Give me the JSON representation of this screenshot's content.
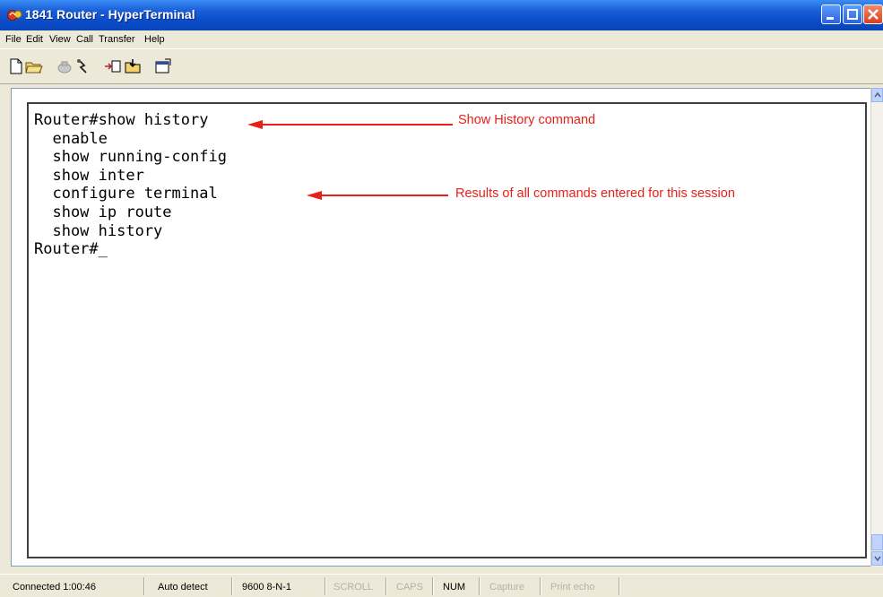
{
  "window": {
    "title": "1841 Router - HyperTerminal"
  },
  "menu": {
    "file": "File",
    "edit": "Edit",
    "view": "View",
    "call": "Call",
    "transfer": "Transfer",
    "help": "Help"
  },
  "toolbar": {
    "icons": [
      "new-icon",
      "open-icon",
      "connect-icon",
      "disconnect-icon",
      "send-icon",
      "receive-icon",
      "properties-icon"
    ]
  },
  "terminal": {
    "lines": [
      "Router#show history",
      "  enable",
      "  show running-config",
      "  show inter",
      "  configure terminal",
      "  show ip route",
      "  show history",
      "Router#_"
    ]
  },
  "annotations": {
    "show_history": "Show History command",
    "results": "Results of all commands entered for this session"
  },
  "status": {
    "connected": "Connected 1:00:46",
    "detect": "Auto detect",
    "baud": "9600 8-N-1",
    "scroll": "SCROLL",
    "caps": "CAPS",
    "num": "NUM",
    "capture": "Capture",
    "print_echo": "Print echo"
  },
  "colors": {
    "annotation": "#e8201a",
    "titlebar": "#0a4cc8"
  }
}
